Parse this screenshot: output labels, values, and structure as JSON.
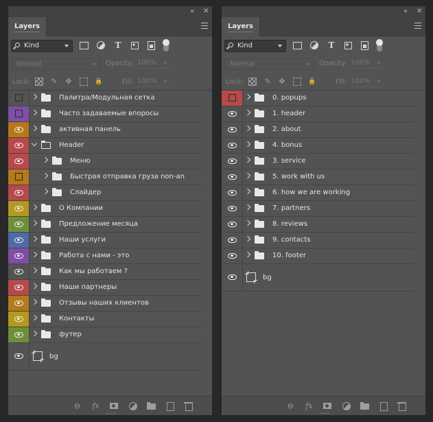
{
  "colors": {
    "red": "#b8494b",
    "purple": "#7f4fa6",
    "orange": "#b5791b",
    "yellow": "#b3991d",
    "green": "#6e8f3a",
    "blue": "#4f6aa6",
    "gray": "#535353"
  },
  "panels": [
    {
      "id": "left",
      "tab_label": "Layers",
      "kind_label": "Kind",
      "blend_mode": "Normal",
      "opacity_label": "Opacity:",
      "opacity_value": "100%",
      "lock_label": "Lock:",
      "fill_label": "Fill:",
      "fill_value": "100%",
      "layers": [
        {
          "name": "Палитра/Модульная сетка",
          "color": "gray",
          "visible": false,
          "indent": 0,
          "expanded": false
        },
        {
          "name": "Часто задаваемые впоросы",
          "color": "purple",
          "visible": false,
          "indent": 0,
          "expanded": false
        },
        {
          "name": "активная панель",
          "color": "orange",
          "visible": true,
          "indent": 0,
          "expanded": false
        },
        {
          "name": "Header",
          "color": "red",
          "visible": true,
          "indent": 0,
          "expanded": true
        },
        {
          "name": "Меню",
          "color": "red",
          "visible": true,
          "indent": 1,
          "expanded": false
        },
        {
          "name": "Быстрая отправка груза non-an",
          "color": "orange",
          "visible": false,
          "indent": 1,
          "expanded": false
        },
        {
          "name": "Слайдер",
          "color": "red",
          "visible": true,
          "indent": 1,
          "expanded": false
        },
        {
          "name": "О Компании",
          "color": "yellow",
          "visible": true,
          "indent": 0,
          "expanded": false
        },
        {
          "name": "Предложение месяца",
          "color": "green",
          "visible": true,
          "indent": 0,
          "expanded": false
        },
        {
          "name": "Наши услуги",
          "color": "blue",
          "visible": true,
          "indent": 0,
          "expanded": false
        },
        {
          "name": "Работа с нами - это",
          "color": "purple",
          "visible": true,
          "indent": 0,
          "expanded": false
        },
        {
          "name": "Как мы работаем ?",
          "color": "gray",
          "visible": true,
          "indent": 0,
          "expanded": false
        },
        {
          "name": "Наши партнеры",
          "color": "red",
          "visible": true,
          "indent": 0,
          "expanded": false
        },
        {
          "name": "Отзывы наших клиентов",
          "color": "orange",
          "visible": true,
          "indent": 0,
          "expanded": false
        },
        {
          "name": "Контакты",
          "color": "yellow",
          "visible": true,
          "indent": 0,
          "expanded": false
        },
        {
          "name": "футер",
          "color": "green",
          "visible": true,
          "indent": 0,
          "expanded": false
        }
      ],
      "bg_layer": "bg"
    },
    {
      "id": "right",
      "tab_label": "Layers",
      "kind_label": "Kind",
      "blend_mode": "Normal",
      "opacity_label": "Opacity:",
      "opacity_value": "100%",
      "lock_label": "Lock:",
      "fill_label": "Fill:",
      "fill_value": "100%",
      "layers": [
        {
          "name": "0. popups",
          "color": "red",
          "visible": false,
          "indent": 0,
          "expanded": false
        },
        {
          "name": "1. header",
          "color": "gray",
          "visible": true,
          "indent": 0,
          "expanded": false
        },
        {
          "name": "2. about",
          "color": "gray",
          "visible": true,
          "indent": 0,
          "expanded": false
        },
        {
          "name": "4. bonus",
          "color": "gray",
          "visible": true,
          "indent": 0,
          "expanded": false
        },
        {
          "name": "3. service",
          "color": "gray",
          "visible": true,
          "indent": 0,
          "expanded": false
        },
        {
          "name": "5. work with us",
          "color": "gray",
          "visible": true,
          "indent": 0,
          "expanded": false
        },
        {
          "name": "6. how we are working",
          "color": "gray",
          "visible": true,
          "indent": 0,
          "expanded": false
        },
        {
          "name": "7. partners",
          "color": "gray",
          "visible": true,
          "indent": 0,
          "expanded": false
        },
        {
          "name": "8. reviews",
          "color": "gray",
          "visible": true,
          "indent": 0,
          "expanded": false
        },
        {
          "name": "9. contacts",
          "color": "gray",
          "visible": true,
          "indent": 0,
          "expanded": false
        },
        {
          "name": "10. footer",
          "color": "gray",
          "visible": true,
          "indent": 0,
          "expanded": false
        }
      ],
      "bg_layer": "bg"
    }
  ],
  "icons": {
    "collapse": "«",
    "close": "✕",
    "type": "T",
    "move": "✥",
    "lock": "🔒",
    "brush": "✎",
    "link": "⊖",
    "fx": "fx"
  }
}
